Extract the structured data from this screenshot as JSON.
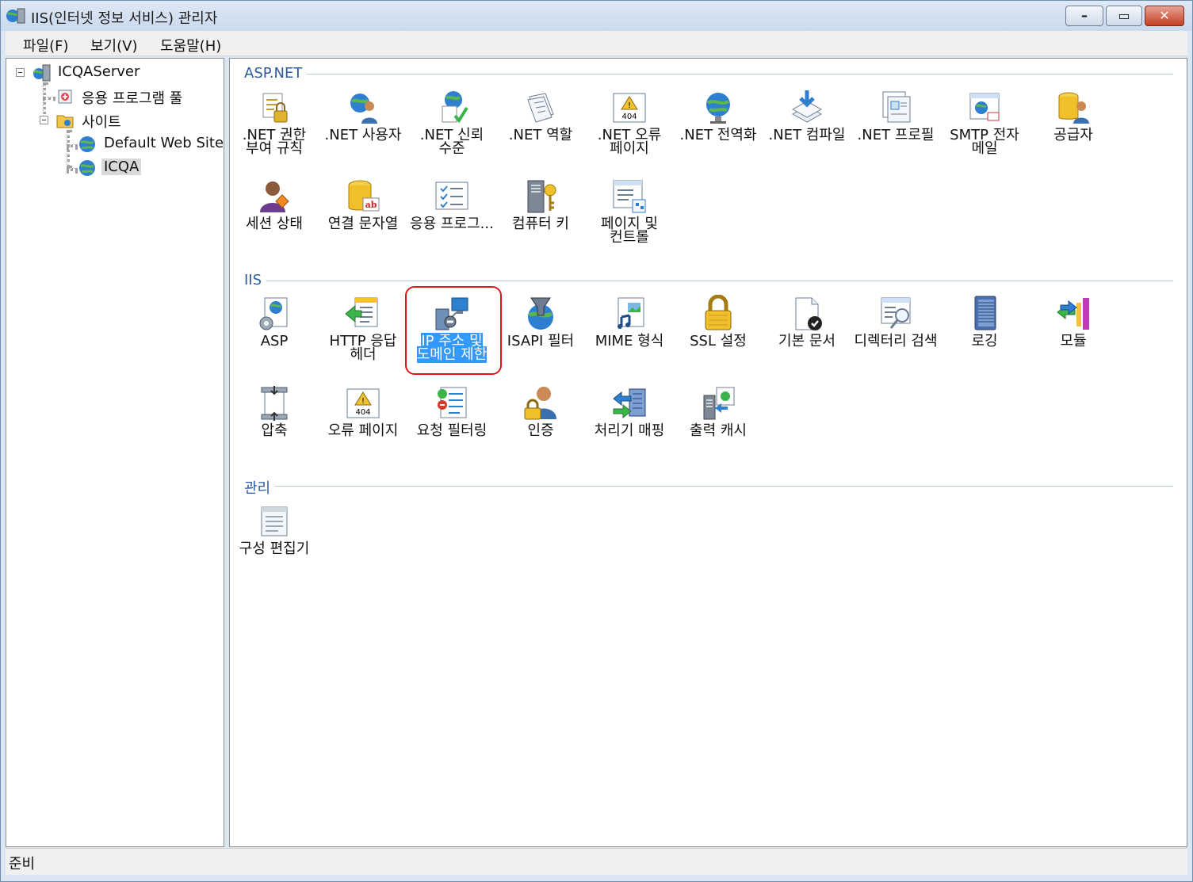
{
  "window": {
    "title": "IIS(인터넷 정보 서비스) 관리자"
  },
  "colors": {
    "section_header": "#2c5aa0",
    "selection": "#3399ff",
    "highlight_box": "#e01818"
  },
  "menu": [
    {
      "label": "파일(F)"
    },
    {
      "label": "보기(V)"
    },
    {
      "label": "도움말(H)"
    }
  ],
  "tree": {
    "server": {
      "label": "ICQAServer",
      "icon": "server-icon"
    },
    "app_pools": {
      "label": "응용 프로그램 풀",
      "icon": "app-pool-icon"
    },
    "sites": {
      "label": "사이트",
      "icon": "folder-icon"
    },
    "default_site": {
      "label": "Default Web Site",
      "icon": "globe-icon"
    },
    "icqa": {
      "label": "ICQA",
      "icon": "globe-icon",
      "selected": true
    }
  },
  "sections": {
    "aspnet": {
      "title": "ASP.NET",
      "items": [
        {
          "label": ".NET 권한 부여 규칙",
          "icon": "authorization-icon"
        },
        {
          "label": ".NET 사용자",
          "icon": "users-icon"
        },
        {
          "label": ".NET 신뢰 수준",
          "icon": "trust-icon"
        },
        {
          "label": ".NET 역할",
          "icon": "roles-icon"
        },
        {
          "label": ".NET 오류 페이지",
          "icon": "error-page-icon"
        },
        {
          "label": ".NET 전역화",
          "icon": "globalization-icon"
        },
        {
          "label": ".NET 컴파일",
          "icon": "compile-icon"
        },
        {
          "label": ".NET 프로필",
          "icon": "profile-icon"
        },
        {
          "label": "SMTP 전자 메일",
          "icon": "smtp-icon"
        },
        {
          "label": "공급자",
          "icon": "providers-icon"
        },
        {
          "label": "세션 상태",
          "icon": "session-icon"
        },
        {
          "label": "연결 문자열",
          "icon": "connection-string-icon"
        },
        {
          "label": "응용 프로그...",
          "icon": "app-settings-icon"
        },
        {
          "label": "컴퓨터 키",
          "icon": "machine-key-icon"
        },
        {
          "label": "페이지 및 컨트롤",
          "icon": "pages-controls-icon"
        }
      ]
    },
    "iis": {
      "title": "IIS",
      "items": [
        {
          "label": "ASP",
          "icon": "asp-icon"
        },
        {
          "label": "HTTP 응답 헤더",
          "icon": "http-headers-icon"
        },
        {
          "label": "IP 주소 및 도메인 제한",
          "icon": "ip-restrictions-icon",
          "selected": true
        },
        {
          "label": "ISAPI 필터",
          "icon": "isapi-filter-icon"
        },
        {
          "label": "MIME 형식",
          "icon": "mime-icon"
        },
        {
          "label": "SSL 설정",
          "icon": "ssl-lock-icon"
        },
        {
          "label": "기본 문서",
          "icon": "default-document-icon"
        },
        {
          "label": "디렉터리 검색",
          "icon": "directory-browsing-icon"
        },
        {
          "label": "로깅",
          "icon": "logging-icon"
        },
        {
          "label": "모듈",
          "icon": "modules-icon"
        },
        {
          "label": "압축",
          "icon": "compression-icon"
        },
        {
          "label": "오류 페이지",
          "icon": "error-pages-icon"
        },
        {
          "label": "요청 필터링",
          "icon": "request-filtering-icon"
        },
        {
          "label": "인증",
          "icon": "authentication-icon"
        },
        {
          "label": "처리기 매핑",
          "icon": "handler-mappings-icon"
        },
        {
          "label": "출력 캐시",
          "icon": "output-cache-icon"
        }
      ]
    },
    "management": {
      "title": "관리",
      "items": [
        {
          "label": "구성 편집기",
          "icon": "config-editor-icon"
        }
      ]
    }
  },
  "statusbar": {
    "text": "준비"
  }
}
